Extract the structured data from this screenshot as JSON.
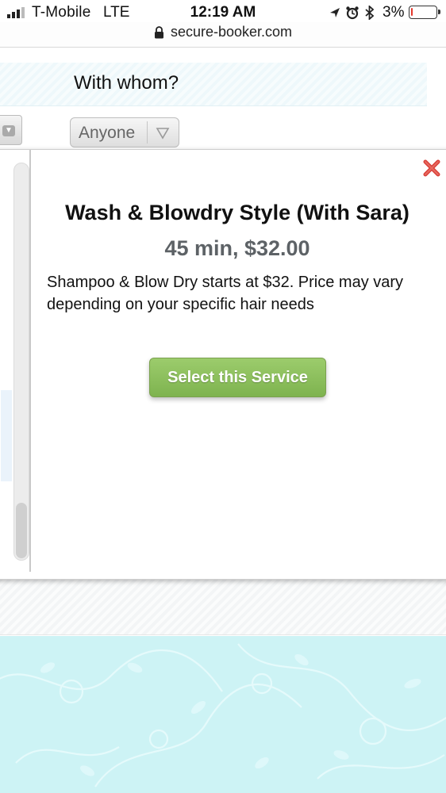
{
  "status_bar": {
    "carrier": "T-Mobile",
    "network": "LTE",
    "time": "12:19 AM",
    "battery_percent": "3%",
    "battery_level": 0.03,
    "icons": [
      "location-icon",
      "alarm-icon",
      "bluetooth-icon"
    ],
    "battery_color": "#e5382c"
  },
  "browser": {
    "url": "secure-booker.com"
  },
  "page": {
    "with_whom_label": "With whom?",
    "staff_select_value": "Anyone"
  },
  "modal": {
    "title": "Wash & Blowdry Style (With Sara)",
    "duration_price": "45 min, $32.00",
    "description": "Shampoo & Blow Dry starts at $32. Price may vary depending on your specific hair needs",
    "select_button": "Select this Service",
    "accent_color": "#8bbf5c",
    "close_color": "#d8413a"
  }
}
